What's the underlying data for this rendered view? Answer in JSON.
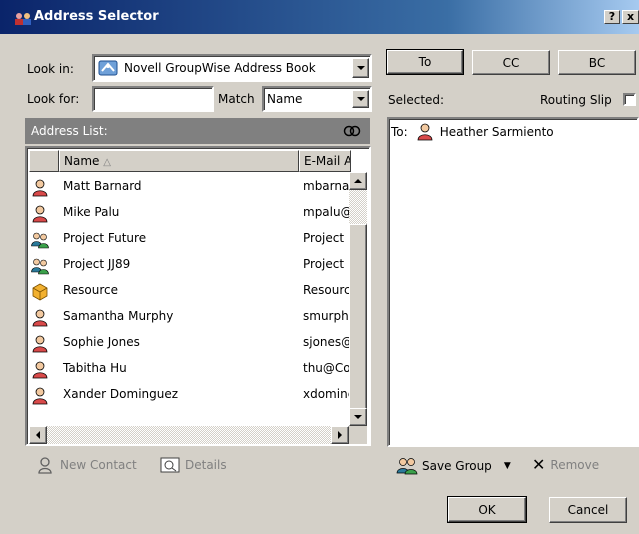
{
  "window": {
    "title": "Address Selector",
    "help_button": "?",
    "close_button": "x"
  },
  "lookin": {
    "label": "Look in:",
    "value": "Novell GroupWise Address Book"
  },
  "lookfor": {
    "label": "Look for:",
    "value": "",
    "match_label": "Match",
    "match_value": "Name"
  },
  "address_list": {
    "title": "Address List:",
    "columns": {
      "name": "Name",
      "email": "E-Mail A"
    },
    "rows": [
      {
        "name": "Matt Barnard",
        "email": "mbarnar",
        "icon": "person-icon"
      },
      {
        "name": "Mike Palu",
        "email": "mpalu@",
        "icon": "person-icon"
      },
      {
        "name": "Project Future",
        "email": "Project I",
        "icon": "group-icon"
      },
      {
        "name": "Project JJ89",
        "email": "Project .",
        "icon": "group-icon"
      },
      {
        "name": "Resource",
        "email": "Resourc",
        "icon": "resource-icon"
      },
      {
        "name": "Samantha Murphy",
        "email": "smurphy",
        "icon": "person-icon"
      },
      {
        "name": "Sophie Jones",
        "email": "sjones@",
        "icon": "person-icon"
      },
      {
        "name": "Tabitha Hu",
        "email": "thu@Co",
        "icon": "person-icon"
      },
      {
        "name": "Xander Dominguez",
        "email": "xdominc",
        "icon": "person-icon"
      }
    ]
  },
  "actions_left": {
    "new_contact": "New Contact",
    "details": "Details"
  },
  "recipient_buttons": {
    "to": "To",
    "cc": "CC",
    "bc": "BC"
  },
  "selected": {
    "label": "Selected:",
    "routing_slip": "Routing Slip",
    "items": [
      {
        "prefix": "To:",
        "name": "Heather Sarmiento"
      }
    ]
  },
  "actions_right": {
    "save_group": "Save Group",
    "remove": "Remove"
  },
  "dialog_buttons": {
    "ok": "OK",
    "cancel": "Cancel"
  },
  "colors": {
    "title_bar": "#0a246a",
    "face": "#d4d0c8",
    "list_header": "#808080"
  }
}
